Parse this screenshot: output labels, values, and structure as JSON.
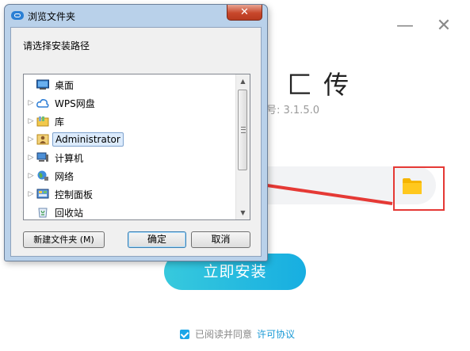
{
  "installer": {
    "title_fragment": "匚 传",
    "version_text": "号: 3.1.5.0",
    "install_button": "立即安装",
    "agree_text": "已阅读并同意",
    "license_link": "许可协议",
    "minimize_glyph": "—",
    "close_glyph": "✕",
    "folder_icon": "folder-icon",
    "highlight_color": "#e53935",
    "accent_color": "#17aee1"
  },
  "dialog": {
    "title": "浏览文件夹",
    "close_glyph": "✕",
    "prompt": "请选择安装路径",
    "tree": [
      {
        "label": "桌面",
        "icon": "desktop-icon",
        "expandable": false,
        "selected": false
      },
      {
        "label": "WPS网盘",
        "icon": "cloud-icon",
        "expandable": true,
        "selected": false
      },
      {
        "label": "库",
        "icon": "library-icon",
        "expandable": true,
        "selected": false
      },
      {
        "label": "Administrator",
        "icon": "user-folder-icon",
        "expandable": true,
        "selected": true
      },
      {
        "label": "计算机",
        "icon": "computer-icon",
        "expandable": true,
        "selected": false
      },
      {
        "label": "网络",
        "icon": "network-icon",
        "expandable": true,
        "selected": false
      },
      {
        "label": "控制面板",
        "icon": "control-panel-icon",
        "expandable": true,
        "selected": false
      },
      {
        "label": "回收站",
        "icon": "recycle-bin-icon",
        "expandable": false,
        "selected": false
      }
    ],
    "new_folder_button": "新建文件夹 (M)",
    "ok_button": "确定",
    "cancel_button": "取消"
  }
}
